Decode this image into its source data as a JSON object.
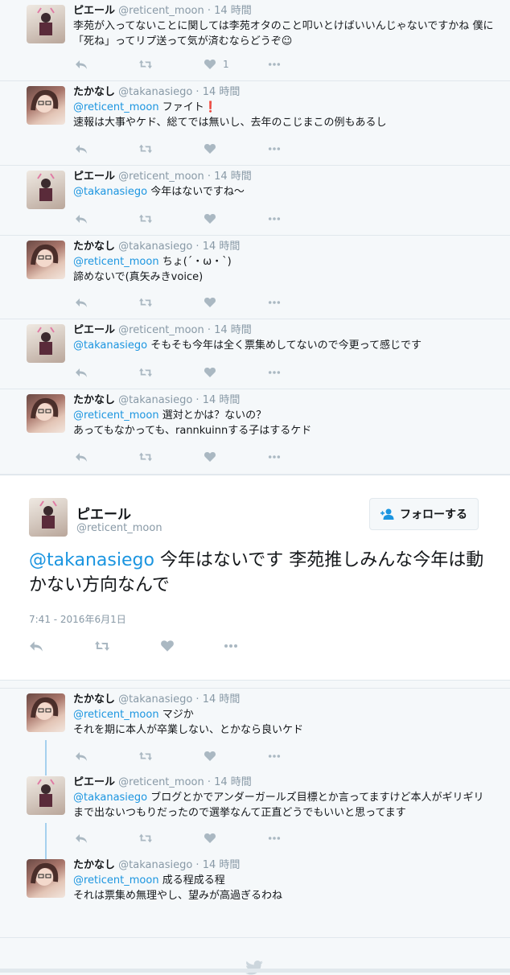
{
  "tweets": [
    {
      "name": "ピエール",
      "handle": "@reticent_moon",
      "time": "14 時間",
      "mention": "",
      "text": "李苑が入ってないことに関しては李苑オタのこと叩いとけばいいんじゃないですかね 僕に「死ね」ってリプ送って気が済むならどうぞ☺",
      "likes": "1",
      "avatar": "pierre"
    },
    {
      "name": "たかなし",
      "handle": "@takanasiego",
      "time": "14 時間",
      "mention": "@reticent_moon",
      "text": " ファイト❗\n速報は大事やケド、総てでは無いし、去年のこじまこの例もあるし",
      "likes": "",
      "avatar": "takanashi"
    },
    {
      "name": "ピエール",
      "handle": "@reticent_moon",
      "time": "14 時間",
      "mention": "@takanasiego",
      "text": " 今年はないですね〜",
      "likes": "",
      "avatar": "pierre"
    },
    {
      "name": "たかなし",
      "handle": "@takanasiego",
      "time": "14 時間",
      "mention": "@reticent_moon",
      "text": " ちょ(´・ω・`)\n諦めないで(真矢みきvoice)",
      "likes": "",
      "avatar": "takanashi"
    },
    {
      "name": "ピエール",
      "handle": "@reticent_moon",
      "time": "14 時間",
      "mention": "@takanasiego",
      "text": " そもそも今年は全く票集めしてないので今更って感じです",
      "likes": "",
      "avatar": "pierre"
    },
    {
      "name": "たかなし",
      "handle": "@takanasiego",
      "time": "14 時間",
      "mention": "@reticent_moon",
      "text": " 選対とかは？ないの？\nあってもなかっても、rannkuinnする子はするケド",
      "likes": "",
      "avatar": "takanashi"
    }
  ],
  "main": {
    "name": "ピエール",
    "handle": "@reticent_moon",
    "follow_label": "フォローする",
    "mention": "@takanasiego",
    "text": " 今年はないです 李苑推しみんな今年は動かない方向なんで",
    "timestamp": "7:41 - 2016年6月1日"
  },
  "replies": [
    {
      "name": "たかなし",
      "handle": "@takanasiego",
      "time": "14 時間",
      "mention": "@reticent_moon",
      "text": " マジか\nそれを期に本人が卒業しない、とかなら良いケド",
      "avatar": "takanashi"
    },
    {
      "name": "ピエール",
      "handle": "@reticent_moon",
      "time": "14 時間",
      "mention": "@takanasiego",
      "text": " ブログとかでアンダーガールズ目標とか言ってますけど本人がギリギリまで出ないつもりだったので選挙なんて正直どうでもいいと思ってます",
      "avatar": "pierre"
    },
    {
      "name": "たかなし",
      "handle": "@takanasiego",
      "time": "14 時間",
      "mention": "@reticent_moon",
      "text": " 成る程成る程\nそれは票集め無理やし、望みが高過ぎるわね",
      "avatar": "takanashi"
    }
  ],
  "icons": {
    "reply": "reply-icon",
    "retweet": "retweet-icon",
    "like": "heart-icon",
    "more": "more-icon",
    "follow": "add-user-icon",
    "footer": "bird-logo-icon"
  },
  "colors": {
    "link": "#1b95e0",
    "muted": "#8899a6",
    "action": "#aab8c2",
    "thread": "#a5d0ee"
  }
}
